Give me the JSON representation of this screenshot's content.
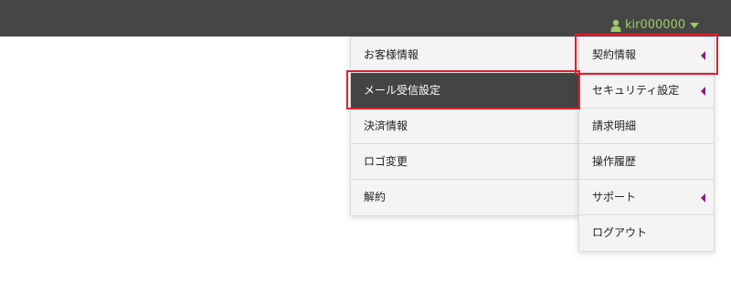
{
  "header": {
    "username": "kir000000",
    "user_icon": "user-icon",
    "caret_icon": "caret-down-icon"
  },
  "main_menu": {
    "items": [
      {
        "label": "契約情報",
        "has_submenu": true
      },
      {
        "label": "セキュリティ設定",
        "has_submenu": true
      },
      {
        "label": "請求明細",
        "has_submenu": false
      },
      {
        "label": "操作履歴",
        "has_submenu": false
      },
      {
        "label": "サポート",
        "has_submenu": true
      },
      {
        "label": "ログアウト",
        "has_submenu": false
      }
    ]
  },
  "sub_menu": {
    "items": [
      {
        "label": "お客様情報"
      },
      {
        "label": "メール受信設定",
        "active": true
      },
      {
        "label": "決済情報"
      },
      {
        "label": "ロゴ変更"
      },
      {
        "label": "解約"
      }
    ]
  },
  "colors": {
    "topbar": "#464646",
    "username": "#9ccc65",
    "active_item": "#444444",
    "submenu_arrow": "#8b1a8b",
    "highlight": "#e0202a"
  }
}
